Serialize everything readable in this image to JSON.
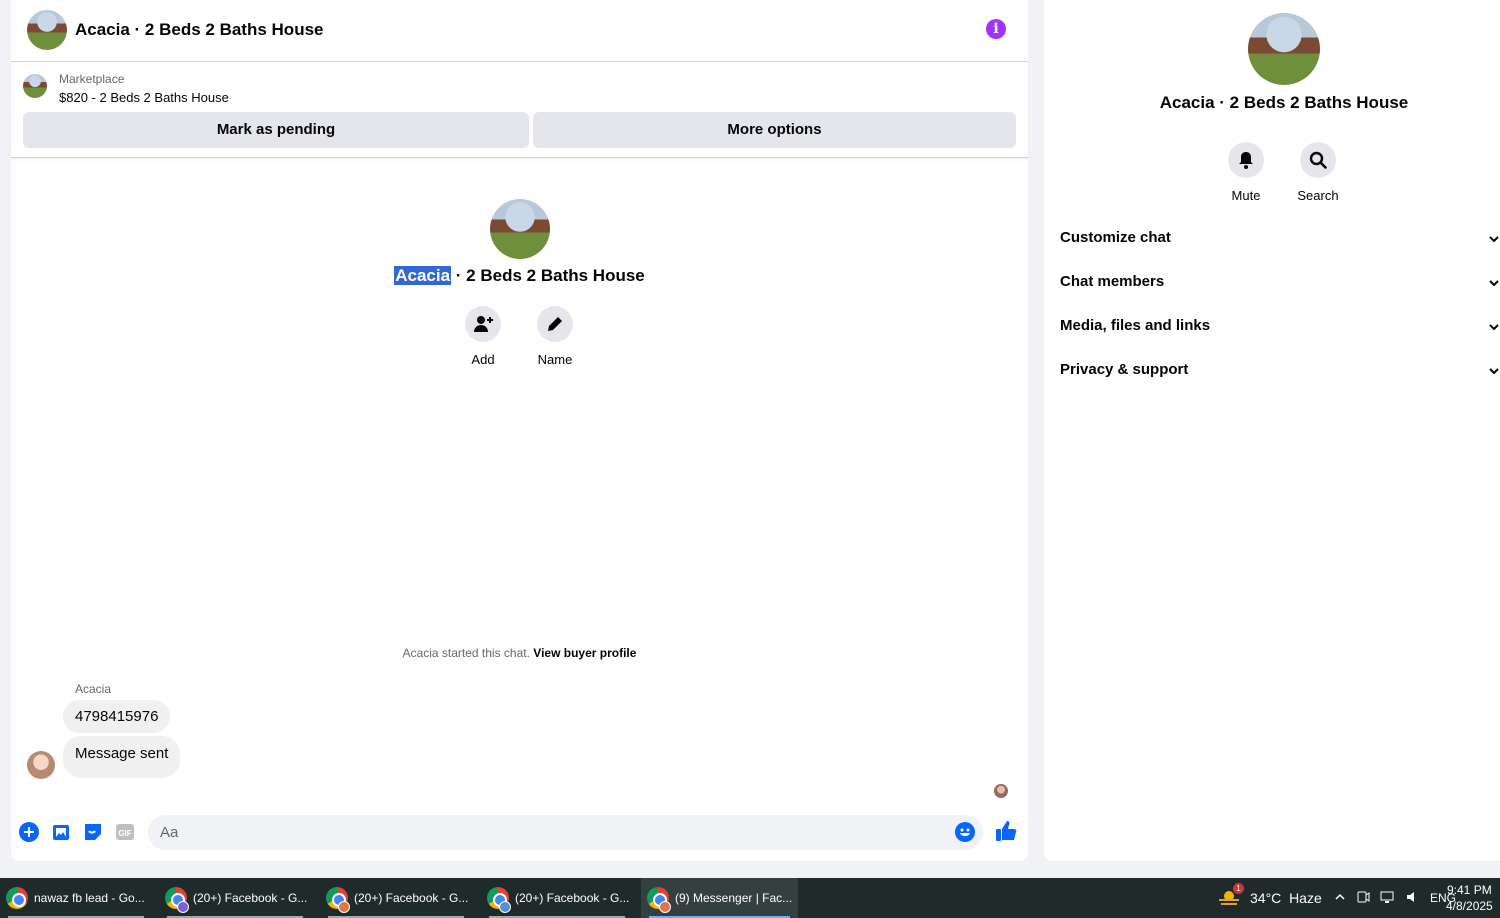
{
  "header": {
    "title": "Acacia · 2 Beds 2 Baths House",
    "info_icon": "info-icon"
  },
  "listing": {
    "category": "Marketplace",
    "price_title": "$820 - 2 Beds 2 Baths House",
    "mark_pending_label": "Mark as pending",
    "more_options_label": "More options"
  },
  "intro": {
    "name_highlight": "Acacia",
    "name_rest": " · 2 Beds 2 Baths House",
    "actions": [
      {
        "label": "Add",
        "icon": "add-person-icon"
      },
      {
        "label": "Name",
        "icon": "pencil-icon"
      }
    ]
  },
  "conversation": {
    "started_text": "Acacia started this chat.",
    "view_profile_label": "View buyer profile",
    "sender_name": "Acacia",
    "messages": [
      "4798415976",
      "Message sent"
    ]
  },
  "composer": {
    "placeholder": "Aa"
  },
  "info_panel": {
    "title": "Acacia · 2 Beds 2 Baths House",
    "actions": [
      {
        "label": "Mute",
        "icon": "bell-icon"
      },
      {
        "label": "Search",
        "icon": "search-icon"
      }
    ],
    "sections": [
      "Customize chat",
      "Chat members",
      "Media, files and links",
      "Privacy & support"
    ]
  },
  "taskbar": {
    "tasks": [
      {
        "label": "nawaz fb lead - Go..."
      },
      {
        "label": "(20+) Facebook - G..."
      },
      {
        "label": "(20+) Facebook - G..."
      },
      {
        "label": "(20+) Facebook - G..."
      },
      {
        "label": "(9) Messenger | Fac..."
      }
    ],
    "weather": {
      "temp": "34°C",
      "condition": "Haze",
      "alert_count": "1"
    },
    "language": "ENG",
    "time": "9:41 PM",
    "date": "4/8/2025"
  },
  "colors": {
    "accent": "#0866ff",
    "info": "#a033ff",
    "highlight": "#3367d6"
  }
}
